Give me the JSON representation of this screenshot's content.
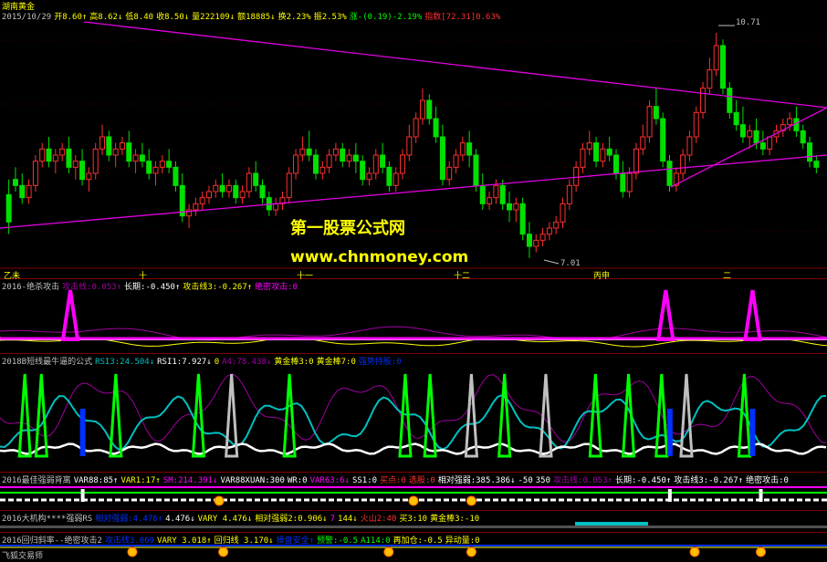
{
  "colors": {
    "up": "#ff3030",
    "down": "#00e000",
    "trend": "#e000e0",
    "grid": "#800000",
    "yellow": "#ffff00",
    "white": "#ffffff",
    "cyan": "#00c0c0",
    "green": "#00ff00",
    "gray": "#c0c0c0",
    "blue": "#0030ff",
    "magenta": "#ff00ff",
    "purple": "#a000a0"
  },
  "main": {
    "title": "湖南黄金",
    "info": [
      {
        "t": "2015/10/29",
        "c": "#c0c0c0"
      },
      {
        "t": "开8.60↑",
        "c": "#ffff00"
      },
      {
        "t": "高8.62↓",
        "c": "#ffff00"
      },
      {
        "t": "低8.40",
        "c": "#ffff00"
      },
      {
        "t": "收8.50↓",
        "c": "#ffff00"
      },
      {
        "t": "量222109↓",
        "c": "#ffff00"
      },
      {
        "t": "额18885↓",
        "c": "#ffff00"
      },
      {
        "t": "换2.23%",
        "c": "#ffff00"
      },
      {
        "t": "振2.53%",
        "c": "#ffff00"
      },
      {
        "t": "涨-(0.19)-2.19%",
        "c": "#00ff00"
      },
      {
        "t": "指数[72.31]0.63%",
        "c": "#ff3030"
      }
    ],
    "high_label": "10.71",
    "low_label": "7.01",
    "watermark_cn": "第一股票公式网",
    "watermark_url": "www.chnmoney.com",
    "date_marks": [
      {
        "t": "乙未"
      },
      {
        "t": "十"
      },
      {
        "t": "十一"
      },
      {
        "t": "十二"
      },
      {
        "t": "丙申"
      },
      {
        "t": "二"
      }
    ]
  },
  "chart_data": {
    "type": "candlestick",
    "title": "湖南黄金",
    "y_high": 10.71,
    "y_low": 7.01,
    "candles": [
      [
        8.05,
        8.3,
        7.6,
        7.4
      ],
      [
        8.3,
        8.5,
        8.2,
        8.1
      ],
      [
        8.2,
        8.4,
        8.0,
        7.9
      ],
      [
        8.0,
        8.3,
        8.2,
        7.9
      ],
      [
        8.2,
        8.7,
        8.6,
        8.1
      ],
      [
        8.6,
        8.9,
        8.8,
        8.5
      ],
      [
        8.8,
        9.0,
        8.6,
        8.5
      ],
      [
        8.6,
        8.8,
        8.7,
        8.4
      ],
      [
        8.7,
        8.9,
        8.8,
        8.6
      ],
      [
        8.8,
        9.0,
        8.5,
        8.4
      ],
      [
        8.5,
        8.7,
        8.6,
        8.3
      ],
      [
        8.6,
        8.8,
        8.3,
        8.2
      ],
      [
        8.3,
        8.5,
        8.4,
        8.1
      ],
      [
        8.4,
        8.9,
        8.8,
        8.3
      ],
      [
        8.8,
        9.2,
        9.0,
        8.7
      ],
      [
        9.0,
        9.1,
        8.7,
        8.6
      ],
      [
        8.7,
        8.9,
        8.8,
        8.5
      ],
      [
        8.8,
        9.0,
        8.9,
        8.7
      ],
      [
        8.9,
        9.1,
        8.6,
        8.5
      ],
      [
        8.6,
        8.8,
        8.7,
        8.4
      ],
      [
        8.7,
        8.9,
        8.6,
        8.5
      ],
      [
        8.6,
        8.8,
        8.4,
        8.3
      ],
      [
        8.4,
        8.6,
        8.5,
        8.2
      ],
      [
        8.5,
        8.7,
        8.6,
        8.4
      ],
      [
        8.6,
        8.8,
        8.5,
        8.4
      ],
      [
        8.5,
        8.6,
        8.2,
        8.1
      ],
      [
        8.2,
        8.4,
        7.7,
        7.6
      ],
      [
        7.7,
        7.9,
        7.8,
        7.5
      ],
      [
        7.8,
        8.0,
        7.9,
        7.7
      ],
      [
        7.9,
        8.1,
        8.0,
        7.8
      ],
      [
        8.0,
        8.2,
        8.1,
        7.9
      ],
      [
        8.1,
        8.3,
        8.2,
        8.0
      ],
      [
        8.2,
        8.4,
        8.1,
        8.0
      ],
      [
        8.1,
        8.3,
        8.2,
        8.0
      ],
      [
        8.2,
        8.3,
        8.0,
        7.9
      ],
      [
        8.0,
        8.2,
        8.1,
        7.9
      ],
      [
        8.1,
        8.5,
        8.4,
        8.0
      ],
      [
        8.4,
        8.6,
        8.2,
        8.1
      ],
      [
        8.2,
        8.3,
        8.0,
        7.9
      ],
      [
        8.0,
        8.1,
        7.8,
        7.7
      ],
      [
        7.8,
        8.0,
        7.9,
        7.7
      ],
      [
        7.9,
        8.1,
        8.0,
        7.8
      ],
      [
        8.0,
        8.5,
        8.4,
        7.9
      ],
      [
        8.4,
        8.8,
        8.7,
        8.3
      ],
      [
        8.7,
        9.0,
        8.8,
        8.6
      ],
      [
        8.8,
        9.1,
        8.7,
        8.6
      ],
      [
        8.7,
        8.8,
        8.4,
        8.3
      ],
      [
        8.4,
        8.6,
        8.5,
        8.3
      ],
      [
        8.5,
        8.8,
        8.7,
        8.4
      ],
      [
        8.7,
        8.9,
        8.8,
        8.6
      ],
      [
        8.8,
        8.9,
        8.6,
        8.5
      ],
      [
        8.6,
        8.8,
        8.7,
        8.5
      ],
      [
        8.7,
        8.9,
        8.6,
        8.4
      ],
      [
        8.6,
        8.7,
        8.3,
        8.2
      ],
      [
        8.3,
        8.5,
        8.4,
        8.2
      ],
      [
        8.4,
        8.8,
        8.7,
        8.3
      ],
      [
        8.7,
        8.9,
        8.5,
        8.4
      ],
      [
        8.5,
        8.6,
        8.2,
        8.1
      ],
      [
        8.2,
        8.5,
        8.4,
        8.1
      ],
      [
        8.4,
        8.8,
        8.7,
        8.3
      ],
      [
        8.7,
        9.2,
        9.0,
        8.6
      ],
      [
        9.0,
        9.4,
        9.3,
        8.9
      ],
      [
        9.3,
        9.8,
        9.6,
        9.2
      ],
      [
        9.6,
        9.7,
        9.3,
        9.2
      ],
      [
        9.3,
        9.5,
        9.0,
        8.9
      ],
      [
        9.0,
        9.2,
        8.3,
        8.2
      ],
      [
        8.3,
        8.6,
        8.5,
        8.2
      ],
      [
        8.5,
        8.8,
        8.7,
        8.4
      ],
      [
        8.7,
        9.0,
        8.9,
        8.6
      ],
      [
        8.9,
        9.1,
        8.7,
        8.5
      ],
      [
        8.7,
        8.8,
        8.2,
        8.1
      ],
      [
        8.2,
        8.4,
        7.9,
        7.8
      ],
      [
        7.9,
        8.1,
        8.0,
        7.8
      ],
      [
        8.0,
        8.3,
        8.2,
        7.9
      ],
      [
        8.2,
        8.3,
        7.9,
        7.8
      ],
      [
        7.9,
        8.1,
        7.8,
        7.6
      ],
      [
        7.8,
        8.0,
        7.9,
        7.6
      ],
      [
        7.9,
        8.0,
        7.4,
        7.3
      ],
      [
        7.4,
        7.6,
        7.2,
        7.01
      ],
      [
        7.2,
        7.4,
        7.3,
        7.1
      ],
      [
        7.3,
        7.5,
        7.4,
        7.2
      ],
      [
        7.4,
        7.6,
        7.5,
        7.3
      ],
      [
        7.5,
        7.7,
        7.6,
        7.4
      ],
      [
        7.6,
        8.0,
        7.9,
        7.5
      ],
      [
        7.9,
        8.3,
        8.2,
        7.8
      ],
      [
        8.2,
        8.6,
        8.5,
        8.1
      ],
      [
        8.5,
        8.9,
        8.8,
        8.4
      ],
      [
        8.8,
        9.1,
        8.9,
        8.7
      ],
      [
        8.9,
        9.0,
        8.6,
        8.5
      ],
      [
        8.6,
        8.9,
        8.8,
        8.5
      ],
      [
        8.8,
        9.0,
        8.7,
        8.6
      ],
      [
        8.7,
        8.8,
        8.4,
        8.3
      ],
      [
        8.4,
        8.6,
        8.1,
        8.0
      ],
      [
        8.1,
        8.5,
        8.4,
        8.0
      ],
      [
        8.4,
        8.9,
        8.8,
        8.3
      ],
      [
        8.8,
        9.2,
        9.0,
        8.7
      ],
      [
        9.0,
        9.6,
        9.5,
        8.9
      ],
      [
        9.5,
        9.8,
        9.3,
        9.2
      ],
      [
        9.3,
        9.4,
        8.6,
        8.5
      ],
      [
        8.6,
        8.7,
        8.2,
        8.1
      ],
      [
        8.2,
        8.5,
        8.4,
        8.1
      ],
      [
        8.4,
        8.8,
        8.7,
        8.3
      ],
      [
        8.7,
        9.1,
        9.0,
        8.6
      ],
      [
        9.0,
        9.5,
        9.4,
        8.9
      ],
      [
        9.4,
        9.9,
        9.8,
        9.3
      ],
      [
        9.8,
        10.3,
        10.1,
        9.7
      ],
      [
        10.1,
        10.71,
        10.5,
        10.0
      ],
      [
        10.5,
        10.6,
        9.8,
        9.7
      ],
      [
        9.8,
        9.9,
        9.4,
        9.3
      ],
      [
        9.4,
        9.6,
        9.2,
        9.1
      ],
      [
        9.2,
        9.5,
        9.0,
        8.9
      ],
      [
        9.0,
        9.2,
        9.1,
        8.8
      ],
      [
        9.1,
        9.3,
        8.9,
        8.8
      ],
      [
        8.9,
        9.1,
        8.8,
        8.7
      ],
      [
        8.8,
        9.0,
        9.0,
        8.7
      ],
      [
        9.0,
        9.2,
        9.1,
        8.9
      ],
      [
        9.1,
        9.3,
        9.2,
        9.0
      ],
      [
        9.2,
        9.4,
        9.3,
        9.1
      ],
      [
        9.3,
        9.5,
        9.1,
        9.0
      ],
      [
        9.1,
        9.2,
        8.9,
        8.8
      ],
      [
        8.9,
        9.0,
        8.6,
        8.5
      ],
      [
        8.6,
        8.7,
        8.5,
        8.4
      ]
    ]
  },
  "p2": {
    "info": [
      {
        "t": "2016-绝杀攻击",
        "c": "#c0c0c0"
      },
      {
        "t": "攻击线:0.053↑",
        "c": "#a000a0"
      },
      {
        "t": "长期:-0.450↑",
        "c": "#ffffff"
      },
      {
        "t": "攻击线3:-0.267↑",
        "c": "#ffff00"
      },
      {
        "t": "绝密攻击:0",
        "c": "#ff00ff"
      }
    ],
    "spikes": [
      0.085,
      0.805,
      0.91
    ]
  },
  "p3": {
    "info": [
      {
        "t": "2018B短线最牛逼的公式",
        "c": "#c0c0c0"
      },
      {
        "t": "RSI3:24.504↓",
        "c": "#00c0c0"
      },
      {
        "t": "RSI1:7.927↓",
        "c": "#ffffff"
      },
      {
        "t": "0",
        "c": "#ffff00"
      },
      {
        "t": "A4:78.438↓",
        "c": "#a000a0"
      },
      {
        "t": "黄金棒3:0",
        "c": "#ffff00"
      },
      {
        "t": "黄金棒7:0",
        "c": "#ffff00"
      },
      {
        "t": "强势持股:0",
        "c": "#0030ff"
      }
    ],
    "green_spikes": [
      0.03,
      0.05,
      0.14,
      0.24,
      0.35,
      0.49,
      0.52,
      0.61,
      0.72,
      0.76,
      0.8,
      0.9
    ],
    "gray_spikes": [
      0.28,
      0.57,
      0.66,
      0.83
    ],
    "blue_spikes": [
      0.1,
      0.81,
      0.91
    ]
  },
  "p4": {
    "info": [
      {
        "t": "2016最佳强弱背离",
        "c": "#c0c0c0"
      },
      {
        "t": "VAR88:85↑",
        "c": "#ffffff"
      },
      {
        "t": "VAR1:17↑",
        "c": "#ffff00"
      },
      {
        "t": "SM:214.391↓",
        "c": "#ff00ff"
      },
      {
        "t": "VAR88XUAN:300",
        "c": "#ffffff"
      },
      {
        "t": "WR:0",
        "c": "#ffffff"
      },
      {
        "t": "VAR63:6↓",
        "c": "#ff00ff"
      },
      {
        "t": "SS1:0",
        "c": "#ffffff"
      },
      {
        "t": "买点:0",
        "c": "#ff3030"
      },
      {
        "t": "选股:0",
        "c": "#ff3030"
      },
      {
        "t": "相对强弱:385.386↓",
        "c": "#ffffff"
      },
      {
        "t": "-50",
        "c": "#ffffff"
      },
      {
        "t": "350",
        "c": "#ffffff"
      },
      {
        "t": "攻击线:0.053↑",
        "c": "#a000a0"
      },
      {
        "t": "长期:-0.450↑",
        "c": "#ffffff"
      },
      {
        "t": "攻击线3:-0.267↑",
        "c": "#ffffff"
      },
      {
        "t": "绝密攻击:0",
        "c": "#ffffff"
      }
    ]
  },
  "p5": {
    "info": [
      {
        "t": "2016大机构****强弱RS",
        "c": "#c0c0c0"
      },
      {
        "t": "相对强弱:4.476↑",
        "c": "#0030ff"
      },
      {
        "t": "4.476↓",
        "c": "#ffffff"
      },
      {
        "t": "VARY 4.476↓",
        "c": "#ffff00"
      },
      {
        "t": "相对强弱2:0.906↓",
        "c": "#ffff00"
      },
      {
        "t": "7",
        "c": "#ff00ff"
      },
      {
        "t": "144↓",
        "c": "#ffff00"
      },
      {
        "t": "火山2:40",
        "c": "#ff3030"
      },
      {
        "t": "买3:10",
        "c": "#ffff00"
      },
      {
        "t": "黄金棒3:-10",
        "c": "#ffff00"
      }
    ]
  },
  "p6": {
    "info": [
      {
        "t": "2016回归斜率--绝密攻击2",
        "c": "#c0c0c0"
      },
      {
        "t": "攻击线3.069",
        "c": "#0030ff"
      },
      {
        "t": "VARY 3.018↑",
        "c": "#ffff00"
      },
      {
        "t": "回归线 3.170↓",
        "c": "#ffff00"
      },
      {
        "t": "操盘安全↑",
        "c": "#0030ff"
      },
      {
        "t": "预警:-0.5",
        "c": "#00ff00"
      },
      {
        "t": "A114:0",
        "c": "#00ff00"
      },
      {
        "t": "再加仓:-0.5",
        "c": "#ffff00"
      },
      {
        "t": "异动量:0",
        "c": "#ffff00"
      }
    ],
    "footer": "飞狐交易师"
  }
}
